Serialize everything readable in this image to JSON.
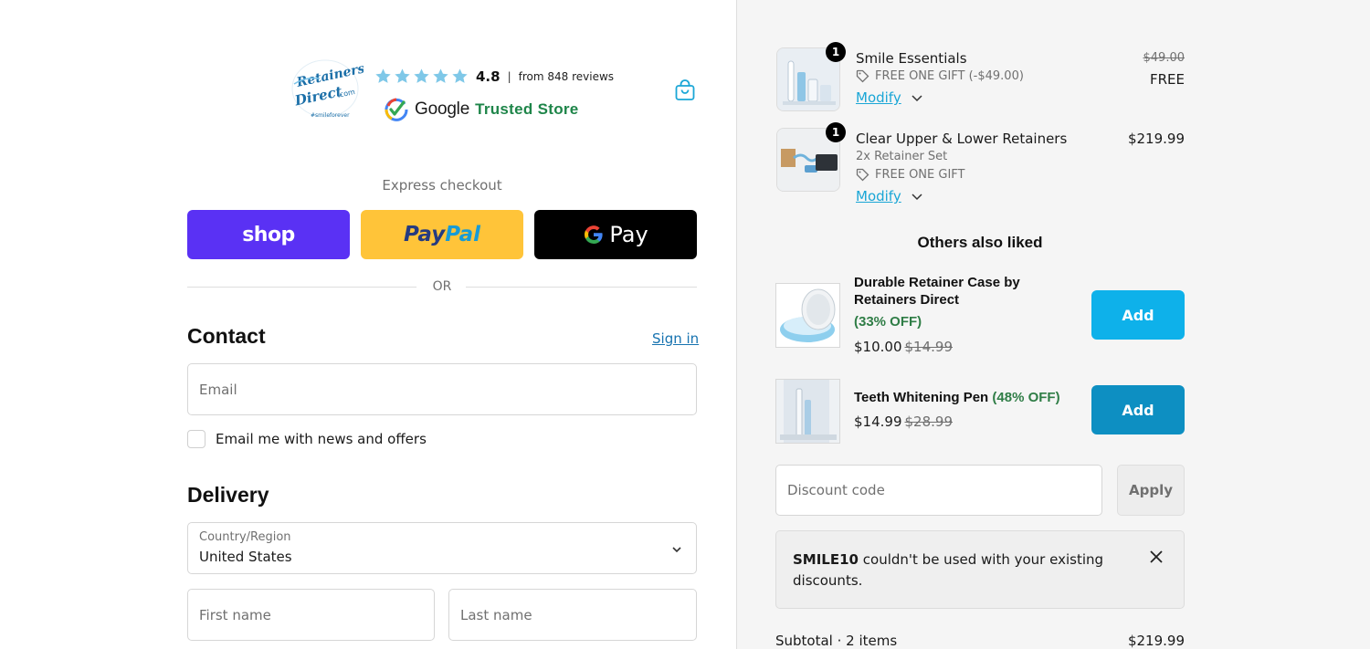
{
  "header": {
    "logo_text": "Retainers Direct.com",
    "logo_tagline": "#smileforever",
    "rating_value": "4.8",
    "rating_separator": "|",
    "rating_count": "from 848 reviews",
    "trusted_google": "Google",
    "trusted_store": "Trusted Store",
    "star_color": "#7fc8e8"
  },
  "express": {
    "title": "Express checkout",
    "shop_label": "shop",
    "paypal_pay": "Pay",
    "paypal_pal": "Pal",
    "gpay_label": "Pay",
    "or_label": "OR"
  },
  "contact": {
    "heading": "Contact",
    "sign_in": "Sign in",
    "email_placeholder": "Email",
    "newsletter_label": "Email me with news and offers"
  },
  "delivery": {
    "heading": "Delivery",
    "country_label": "Country/Region",
    "country_value": "United States",
    "first_name_placeholder": "First name",
    "last_name_placeholder": "Last name"
  },
  "cart": {
    "items": [
      {
        "quantity": "1",
        "name": "Smile Essentials",
        "gift": "FREE ONE GIFT (-$49.00)",
        "modify": "Modify",
        "original_price": "$49.00",
        "price": "FREE"
      },
      {
        "quantity": "1",
        "name": "Clear Upper & Lower Retainers",
        "variant": "2x Retainer Set",
        "gift": "FREE ONE GIFT",
        "modify": "Modify",
        "price": "$219.99"
      }
    ]
  },
  "upsell": {
    "title": "Others also liked",
    "items": [
      {
        "name_line1": "Durable Retainer Case by",
        "name_line2": "Retainers Direct",
        "discount": "(33% OFF)",
        "price": "$10.00",
        "was": "$14.99",
        "button": "Add",
        "button_color": "#0eb1ea"
      },
      {
        "name": "Teeth Whitening Pen",
        "discount": "(48% OFF)",
        "price": "$14.99",
        "was": "$28.99",
        "button": "Add",
        "button_color": "#0d8fc2"
      }
    ]
  },
  "discount": {
    "placeholder": "Discount code",
    "apply": "Apply",
    "notice_code": "SMILE10",
    "notice_message": " couldn't be used with your existing discounts."
  },
  "summary": {
    "subtotal_label": "Subtotal · 2 items",
    "subtotal_value": "$219.99"
  }
}
